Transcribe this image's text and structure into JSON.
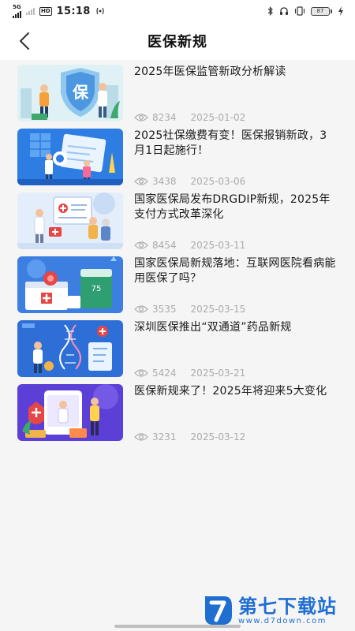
{
  "status_bar": {
    "network_top": "5G",
    "hd_label": "HD",
    "time": "15:18",
    "battery_level": "87"
  },
  "header": {
    "title": "医保新规"
  },
  "articles": [
    {
      "title": "2025年医保监管新政分析解读",
      "views": "8234",
      "date": "2025-01-02"
    },
    {
      "title": "2025社保缴费有变！医保报销新政，3月1日起施行！",
      "views": "3438",
      "date": "2025-03-06"
    },
    {
      "title": "国家医保局发布DRGDIP新规，2025年支付方式改革深化",
      "views": "8454",
      "date": "2025-03-11"
    },
    {
      "title": "国家医保局新规落地：互联网医院看病能用医保了吗？",
      "views": "3535",
      "date": "2025-03-15"
    },
    {
      "title": "深圳医保推出“双通道”药品新规",
      "views": "5424",
      "date": "2025-03-21"
    },
    {
      "title": "医保新规来了！2025年将迎来5大变化",
      "views": "3231",
      "date": "2025-03-12"
    }
  ],
  "thumb_labels": {
    "bao": "保",
    "percent": "75"
  },
  "watermark": {
    "name": "第七下载站",
    "url": "www.d7down.com"
  },
  "colors": {
    "accent": "#1f6fd1",
    "meta_text": "#aaaaaa",
    "list_bg": "#f5f5f5"
  }
}
